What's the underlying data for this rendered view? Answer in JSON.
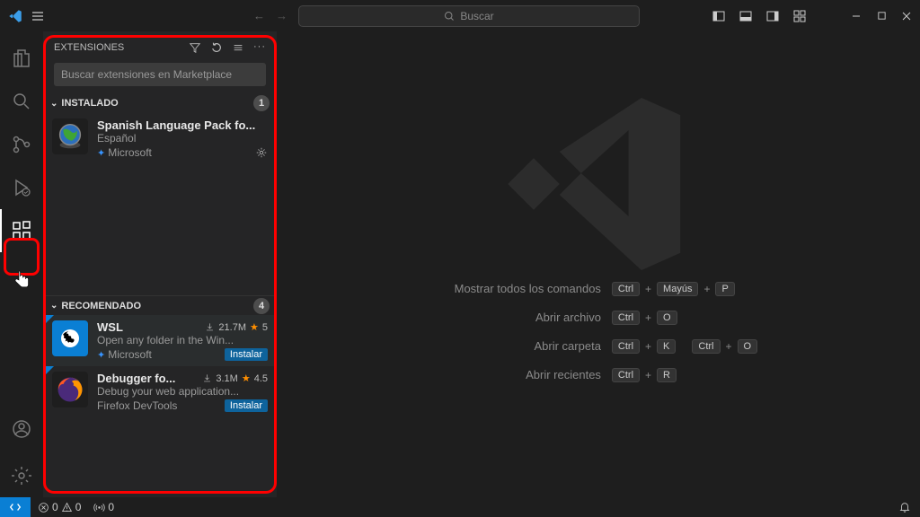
{
  "search": {
    "placeholder": "Buscar"
  },
  "sidebar": {
    "title": "EXTENSIONES",
    "search_placeholder": "Buscar extensiones en Marketplace",
    "installed": {
      "label": "INSTALADO",
      "count": "1",
      "items": [
        {
          "name": "Spanish Language Pack fo...",
          "desc": "Español",
          "publisher": "Microsoft",
          "verified": true
        }
      ]
    },
    "recommended": {
      "label": "RECOMENDADO",
      "count": "4",
      "items": [
        {
          "name": "WSL",
          "downloads": "21.7M",
          "rating": "5",
          "desc": "Open any folder in the Win...",
          "publisher": "Microsoft",
          "verified": true,
          "install": "Instalar"
        },
        {
          "name": "Debugger fo...",
          "downloads": "3.1M",
          "rating": "4.5",
          "desc": "Debug your web application...",
          "publisher": "Firefox DevTools",
          "verified": false,
          "install": "Instalar"
        }
      ]
    }
  },
  "shortcuts": [
    {
      "label": "Mostrar todos los comandos",
      "keys": [
        "Ctrl",
        "+",
        "Mayús",
        "+",
        "P"
      ]
    },
    {
      "label": "Abrir archivo",
      "keys": [
        "Ctrl",
        "+",
        "O"
      ]
    },
    {
      "label": "Abrir carpeta",
      "keys": [
        "Ctrl",
        "+",
        "K",
        " ",
        "Ctrl",
        "+",
        "O"
      ]
    },
    {
      "label": "Abrir recientes",
      "keys": [
        "Ctrl",
        "+",
        "R"
      ]
    }
  ],
  "statusbar": {
    "errors": "0",
    "warnings": "0",
    "ports": "0"
  }
}
